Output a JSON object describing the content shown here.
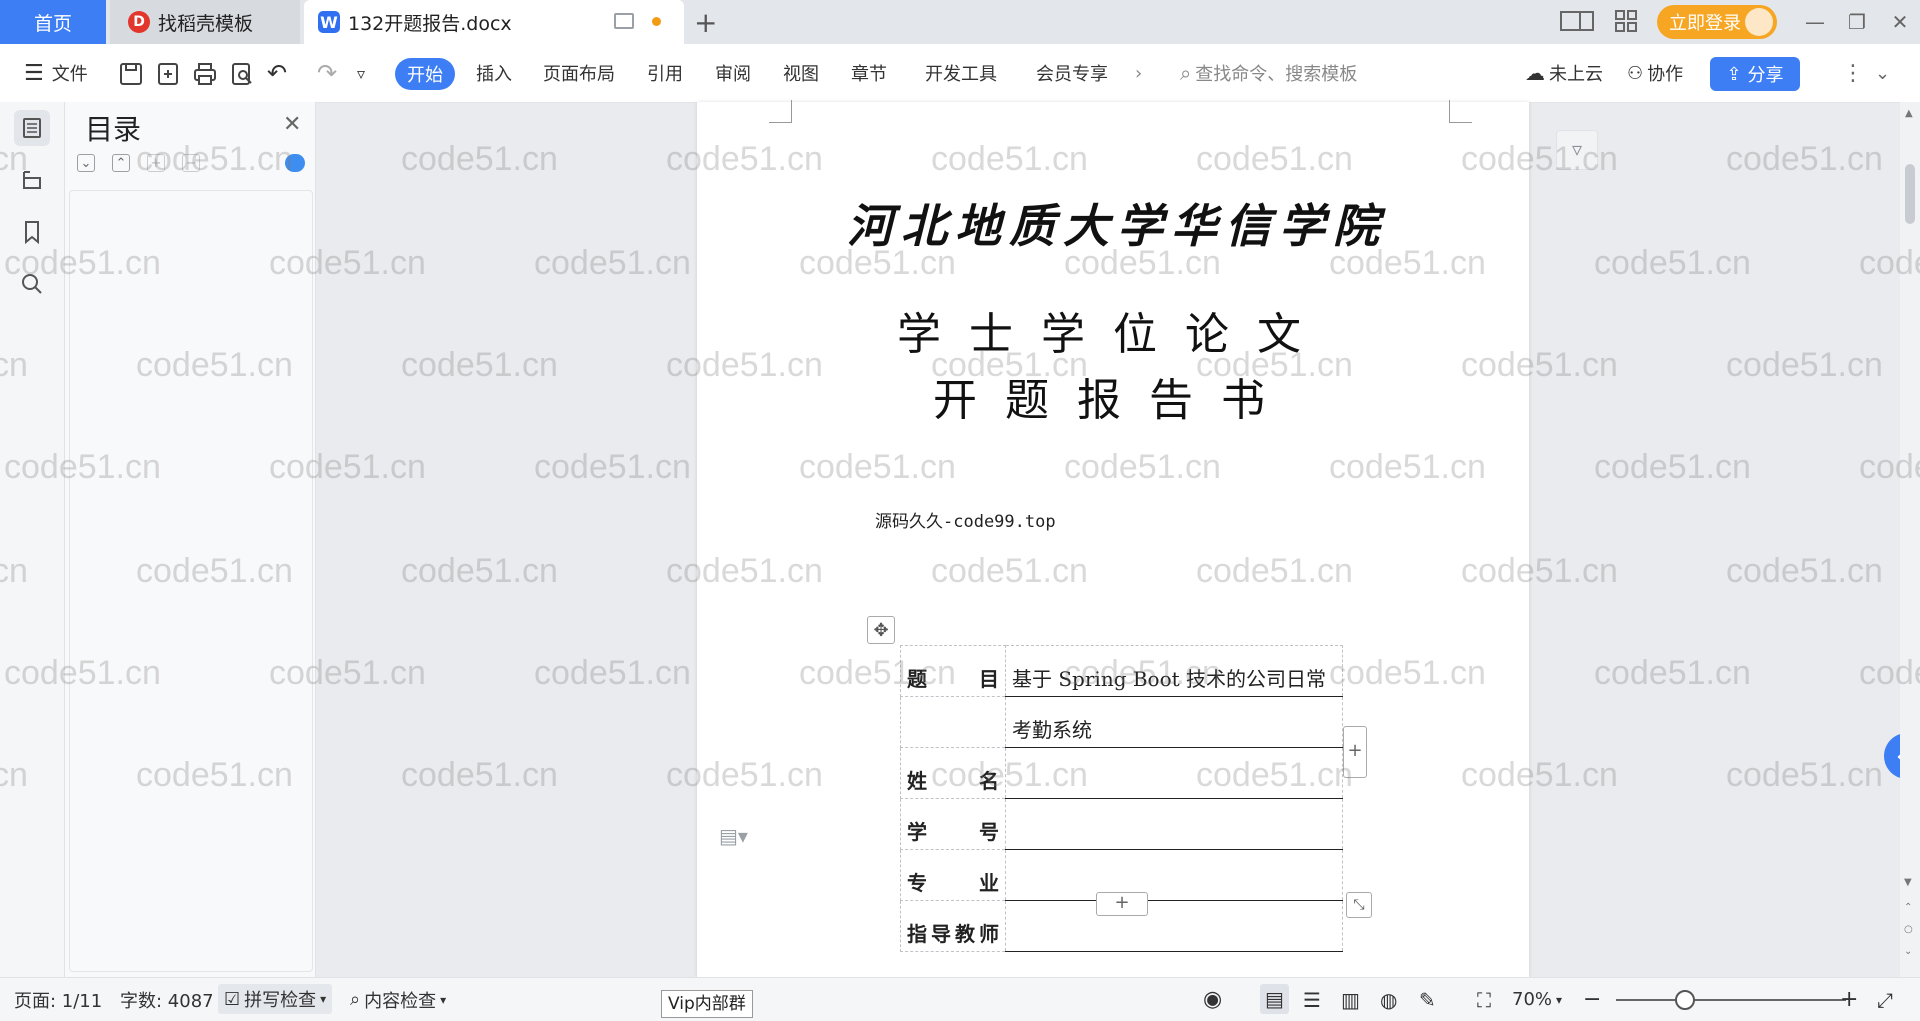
{
  "tabs": {
    "home": "首页",
    "template": "找稻壳模板",
    "document": "132开题报告.docx",
    "login": "立即登录"
  },
  "toolbar": {
    "file": "文件",
    "start": "开始",
    "insert": "插入",
    "layout": "页面布局",
    "reference": "引用",
    "review": "审阅",
    "view": "视图",
    "chapter": "章节",
    "devtools": "开发工具",
    "member": "会员专享",
    "search_placeholder": "查找命令、搜索模板",
    "cloud": "未上云",
    "collab": "协作",
    "share": "分享"
  },
  "toc": {
    "title": "目录"
  },
  "document": {
    "school": "河北地质大学华信学院",
    "title_line1": "学士学位论文",
    "title_line2": "开题报告书",
    "source": "源码久久-code99.top",
    "table": [
      {
        "label": "题    目",
        "value": "基于 Spring Boot 技术的公司日常"
      },
      {
        "label": "",
        "value": "考勤系统"
      },
      {
        "label": "姓    名",
        "value": ""
      },
      {
        "label": "学    号",
        "value": ""
      },
      {
        "label": "专    业",
        "value": ""
      },
      {
        "label": "指导教师",
        "value": ""
      }
    ]
  },
  "statusbar": {
    "page": "页面: 1/11",
    "words": "字数: 4087",
    "spell": "拼写检查",
    "content": "内容检查",
    "vip_tooltip": "Vip内部群",
    "zoom": "70%"
  },
  "watermark": "code51.cn",
  "colors": {
    "accent": "#3d7ef5",
    "login": "#f6a623",
    "unsaved_dot": "#f39b12"
  }
}
